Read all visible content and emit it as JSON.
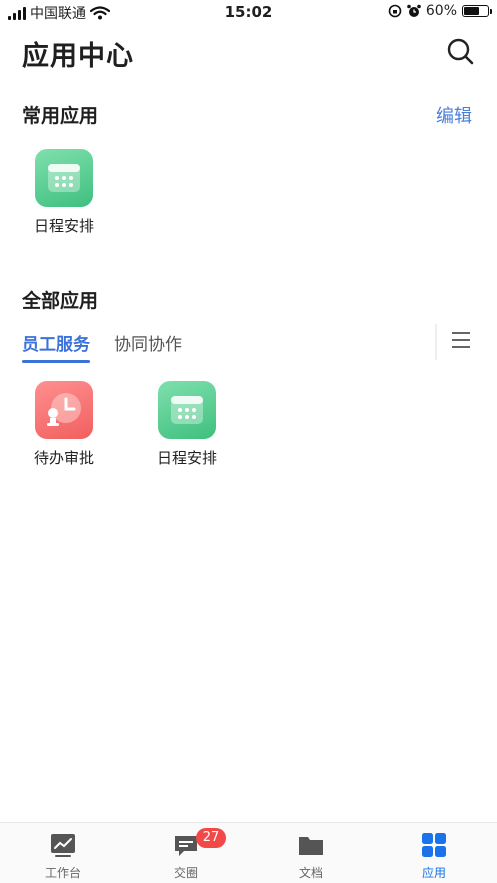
{
  "status": {
    "carrier": "中国联通",
    "time": "15:02",
    "battery": "60%"
  },
  "header": {
    "title": "应用中心"
  },
  "frequent": {
    "title": "常用应用",
    "edit_label": "编辑",
    "apps": [
      {
        "label": "日程安排",
        "icon": "calendar-icon",
        "color": "#4cc68a"
      }
    ]
  },
  "all": {
    "title": "全部应用",
    "tabs": [
      {
        "label": "员工服务",
        "active": true
      },
      {
        "label": "协同协作",
        "active": false
      }
    ],
    "apps": [
      {
        "label": "待办审批",
        "icon": "approval-clock-icon",
        "color": "#f26a6a"
      },
      {
        "label": "日程安排",
        "icon": "calendar-icon",
        "color": "#4cc68a"
      }
    ]
  },
  "tabbar": {
    "items": [
      {
        "label": "工作台",
        "icon": "workbench-chart-icon"
      },
      {
        "label": "交圈",
        "icon": "chat-icon",
        "badge": "27"
      },
      {
        "label": "文档",
        "icon": "folder-icon"
      },
      {
        "label": "应用",
        "icon": "grid-apps-icon",
        "active": true
      }
    ]
  },
  "colors": {
    "accent": "#3b72d9",
    "badge": "#f24848"
  }
}
